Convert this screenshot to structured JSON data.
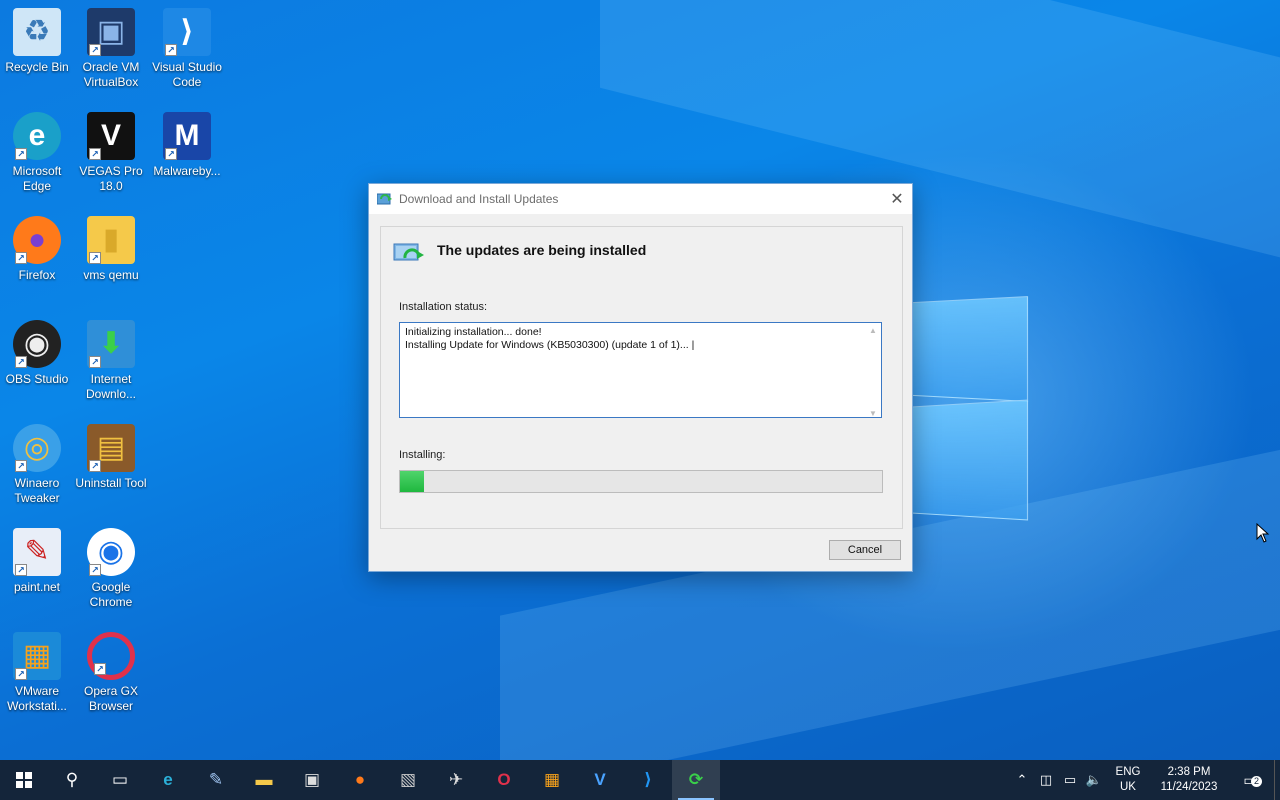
{
  "desktop": {
    "icons": [
      {
        "label": "Recycle Bin",
        "icon": "recycle-bin-icon"
      },
      {
        "label": "Oracle VM VirtualBox",
        "icon": "virtualbox-icon"
      },
      {
        "label": "Visual Studio Code",
        "icon": "vscode-icon"
      },
      {
        "label": "Microsoft Edge",
        "icon": "edge-icon"
      },
      {
        "label": "VEGAS Pro 18.0",
        "icon": "vegas-icon"
      },
      {
        "label": "Malwareby...",
        "icon": "malwarebytes-icon"
      },
      {
        "label": "Firefox",
        "icon": "firefox-icon"
      },
      {
        "label": "vms qemu",
        "icon": "folder-icon"
      },
      {
        "label": "OBS Studio",
        "icon": "obs-icon"
      },
      {
        "label": "Internet Downlo...",
        "icon": "idm-icon"
      },
      {
        "label": "Winaero Tweaker",
        "icon": "winaero-icon"
      },
      {
        "label": "Uninstall Tool",
        "icon": "uninstall-tool-icon"
      },
      {
        "label": "paint.net",
        "icon": "paintnet-icon"
      },
      {
        "label": "Google Chrome",
        "icon": "chrome-icon"
      },
      {
        "label": "VMware Workstati...",
        "icon": "vmware-icon"
      },
      {
        "label": "Opera GX Browser",
        "icon": "opera-gx-icon"
      }
    ]
  },
  "dialog": {
    "title": "Download and Install Updates",
    "heading": "The updates are being installed",
    "status_label": "Installation status:",
    "log_lines": [
      "Initializing installation... done!",
      "Installing Update for Windows (KB5030300) (update 1 of 1)... |"
    ],
    "installing_label": "Installing:",
    "progress_fraction": 0.05,
    "cancel_label": "Cancel"
  },
  "taskbar": {
    "start_icon": "windows-start-icon",
    "pinned": [
      "search-icon",
      "task-view-icon",
      "edge-icon",
      "paintnet-icon",
      "file-explorer-icon",
      "store-icon",
      "firefox-icon",
      "screenshot-tool-icon",
      "winaero-icon",
      "opera-gx-icon",
      "vmware-icon",
      "vegas-icon",
      "vscode-icon",
      "windows-update-icon"
    ],
    "lang_top": "ENG",
    "lang_bottom": "UK",
    "time": "2:38 PM",
    "date": "11/24/2023",
    "notification_count": "2"
  },
  "colors": {
    "accent": "#0078d7",
    "progress": "#2fc84f",
    "taskbar": "#14253a"
  }
}
